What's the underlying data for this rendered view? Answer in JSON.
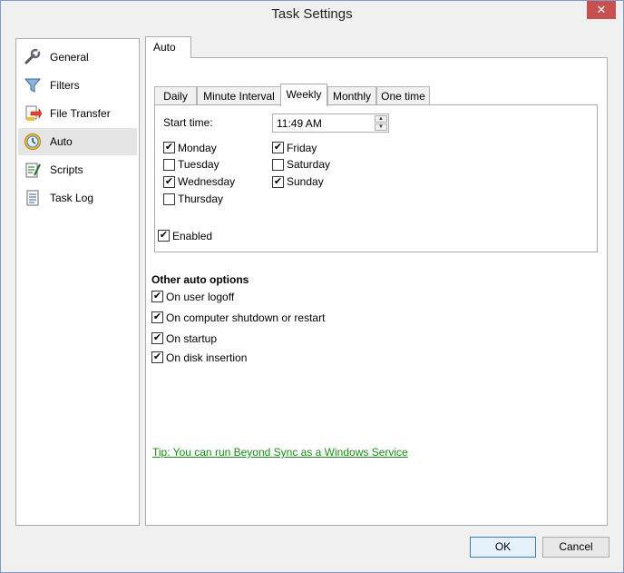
{
  "window": {
    "title": "Task Settings",
    "close_glyph": "✕"
  },
  "nav": {
    "items": [
      {
        "label": "General",
        "icon": "wrench-icon"
      },
      {
        "label": "Filters",
        "icon": "funnel-icon"
      },
      {
        "label": "File Transfer",
        "icon": "file-transfer-icon"
      },
      {
        "label": "Auto",
        "icon": "clock-icon",
        "selected": true
      },
      {
        "label": "Scripts",
        "icon": "script-icon"
      },
      {
        "label": "Task Log",
        "icon": "log-icon"
      }
    ]
  },
  "main": {
    "tab_label": "Auto",
    "subtabs": [
      "Daily",
      "Minute Interval",
      "Weekly",
      "Monthly",
      "One time"
    ],
    "active_subtab": "Weekly",
    "weekly": {
      "start_time_label": "Start time:",
      "start_time_value": "11:49 AM",
      "days": [
        {
          "label": "Monday",
          "checked": true
        },
        {
          "label": "Tuesday",
          "checked": false
        },
        {
          "label": "Wednesday",
          "checked": true
        },
        {
          "label": "Thursday",
          "checked": false
        },
        {
          "label": "Friday",
          "checked": true
        },
        {
          "label": "Saturday",
          "checked": false
        },
        {
          "label": "Sunday",
          "checked": true
        }
      ],
      "enabled_label": "Enabled",
      "enabled_checked": true
    },
    "other_options": {
      "heading": "Other auto options",
      "items": [
        {
          "label": "On user logoff",
          "checked": true
        },
        {
          "label": "On computer shutdown or restart",
          "checked": true
        },
        {
          "label": "On startup",
          "checked": true
        },
        {
          "label": "On disk insertion",
          "checked": true
        }
      ]
    },
    "tip_link": "Tip: You can run Beyond Sync as a Windows Service"
  },
  "buttons": {
    "ok": "OK",
    "cancel": "Cancel"
  },
  "check_glyph": "✔"
}
